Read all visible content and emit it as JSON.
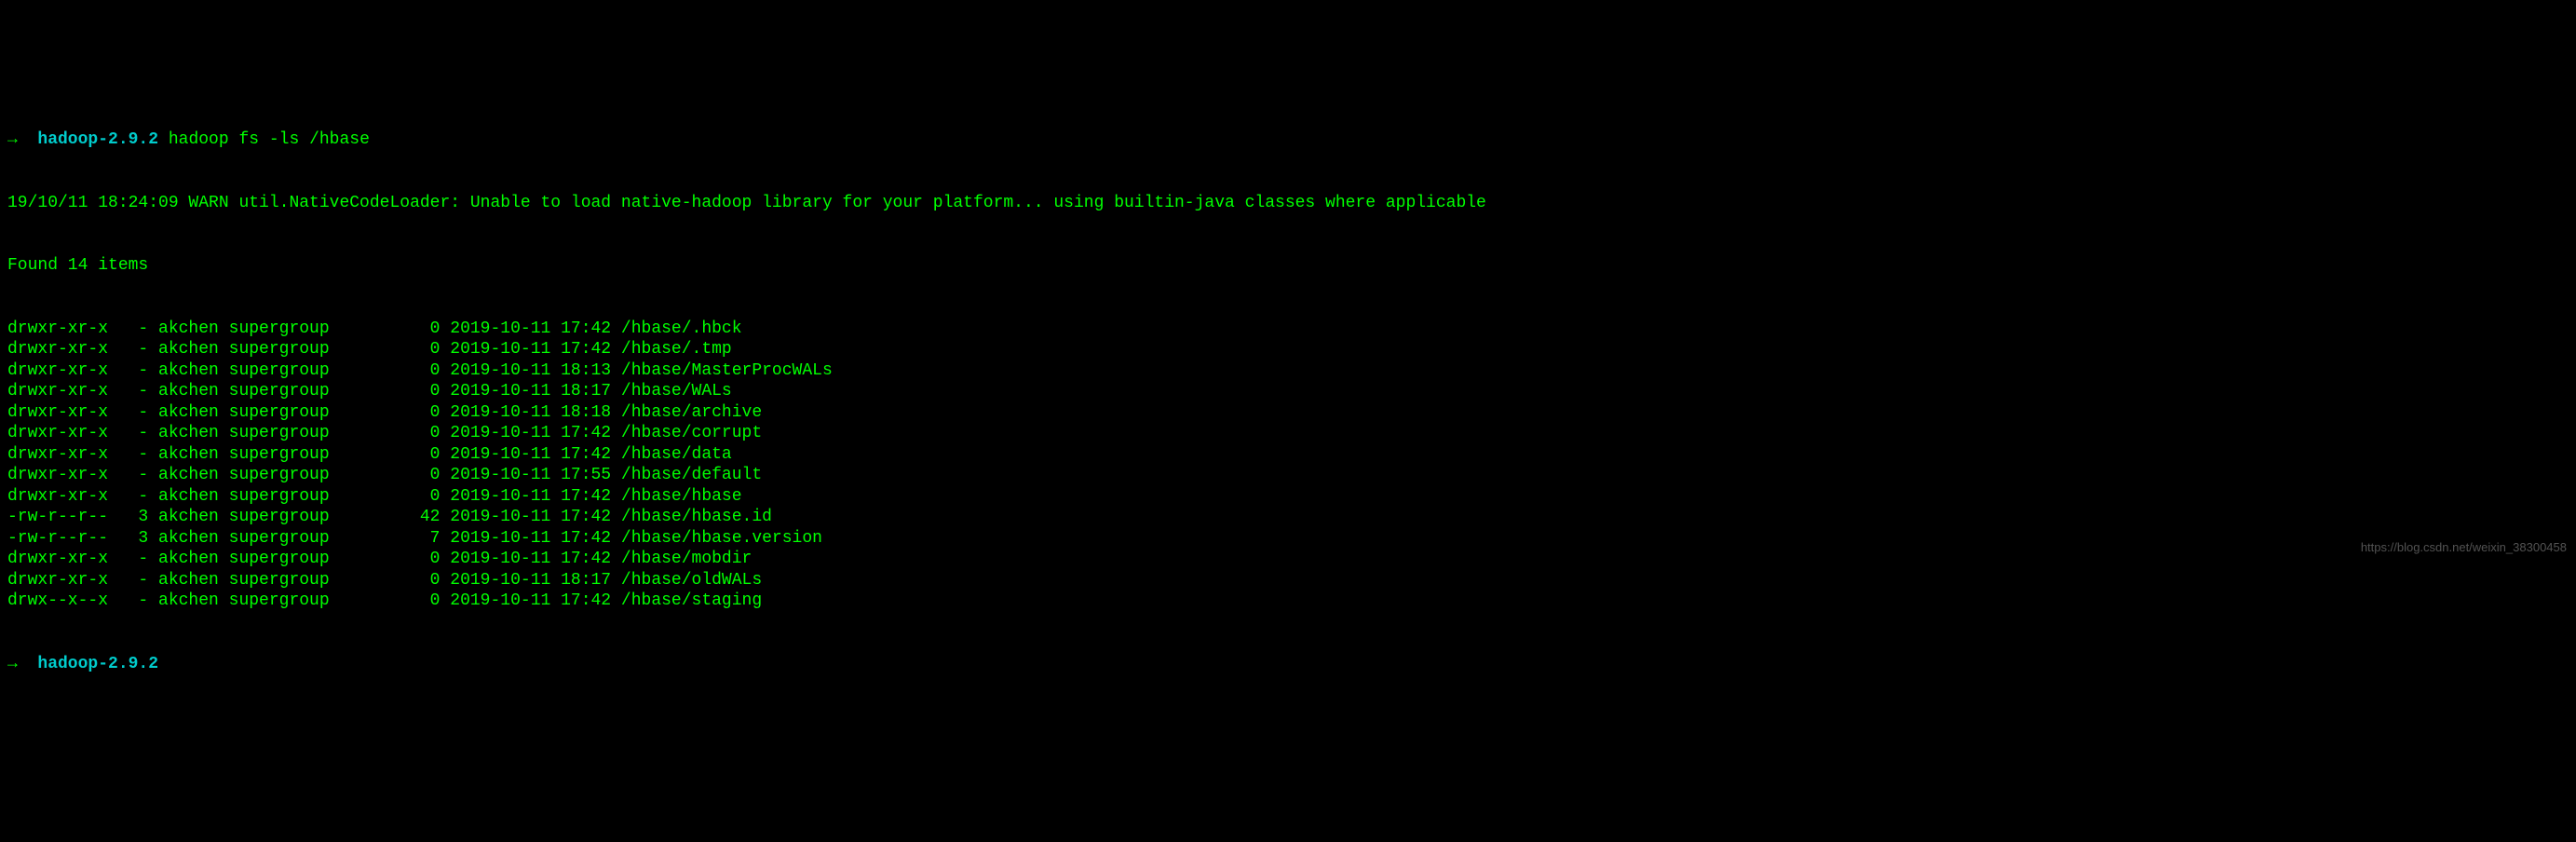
{
  "prompt1": {
    "arrow": "→  ",
    "host": "hadoop-2.9.2",
    "separator": " ",
    "command": "hadoop fs -ls /hbase"
  },
  "warn_line": "19/10/11 18:24:09 WARN util.NativeCodeLoader: Unable to load native-hadoop library for your platform... using builtin-java classes where applicable",
  "found_line": "Found 14 items",
  "listing": [
    {
      "perms": "drwxr-xr-x",
      "repl": "-",
      "owner": "akchen",
      "group": "supergroup",
      "size": "0",
      "date": "2019-10-11",
      "time": "17:42",
      "path": "/hbase/.hbck"
    },
    {
      "perms": "drwxr-xr-x",
      "repl": "-",
      "owner": "akchen",
      "group": "supergroup",
      "size": "0",
      "date": "2019-10-11",
      "time": "17:42",
      "path": "/hbase/.tmp"
    },
    {
      "perms": "drwxr-xr-x",
      "repl": "-",
      "owner": "akchen",
      "group": "supergroup",
      "size": "0",
      "date": "2019-10-11",
      "time": "18:13",
      "path": "/hbase/MasterProcWALs"
    },
    {
      "perms": "drwxr-xr-x",
      "repl": "-",
      "owner": "akchen",
      "group": "supergroup",
      "size": "0",
      "date": "2019-10-11",
      "time": "18:17",
      "path": "/hbase/WALs"
    },
    {
      "perms": "drwxr-xr-x",
      "repl": "-",
      "owner": "akchen",
      "group": "supergroup",
      "size": "0",
      "date": "2019-10-11",
      "time": "18:18",
      "path": "/hbase/archive"
    },
    {
      "perms": "drwxr-xr-x",
      "repl": "-",
      "owner": "akchen",
      "group": "supergroup",
      "size": "0",
      "date": "2019-10-11",
      "time": "17:42",
      "path": "/hbase/corrupt"
    },
    {
      "perms": "drwxr-xr-x",
      "repl": "-",
      "owner": "akchen",
      "group": "supergroup",
      "size": "0",
      "date": "2019-10-11",
      "time": "17:42",
      "path": "/hbase/data"
    },
    {
      "perms": "drwxr-xr-x",
      "repl": "-",
      "owner": "akchen",
      "group": "supergroup",
      "size": "0",
      "date": "2019-10-11",
      "time": "17:55",
      "path": "/hbase/default"
    },
    {
      "perms": "drwxr-xr-x",
      "repl": "-",
      "owner": "akchen",
      "group": "supergroup",
      "size": "0",
      "date": "2019-10-11",
      "time": "17:42",
      "path": "/hbase/hbase"
    },
    {
      "perms": "-rw-r--r--",
      "repl": "3",
      "owner": "akchen",
      "group": "supergroup",
      "size": "42",
      "date": "2019-10-11",
      "time": "17:42",
      "path": "/hbase/hbase.id"
    },
    {
      "perms": "-rw-r--r--",
      "repl": "3",
      "owner": "akchen",
      "group": "supergroup",
      "size": "7",
      "date": "2019-10-11",
      "time": "17:42",
      "path": "/hbase/hbase.version"
    },
    {
      "perms": "drwxr-xr-x",
      "repl": "-",
      "owner": "akchen",
      "group": "supergroup",
      "size": "0",
      "date": "2019-10-11",
      "time": "17:42",
      "path": "/hbase/mobdir"
    },
    {
      "perms": "drwxr-xr-x",
      "repl": "-",
      "owner": "akchen",
      "group": "supergroup",
      "size": "0",
      "date": "2019-10-11",
      "time": "18:17",
      "path": "/hbase/oldWALs"
    },
    {
      "perms": "drwx--x--x",
      "repl": "-",
      "owner": "akchen",
      "group": "supergroup",
      "size": "0",
      "date": "2019-10-11",
      "time": "17:42",
      "path": "/hbase/staging"
    }
  ],
  "prompt2": {
    "arrow": "→  ",
    "host": "hadoop-2.9.2"
  },
  "watermark": "https://blog.csdn.net/weixin_38300458"
}
